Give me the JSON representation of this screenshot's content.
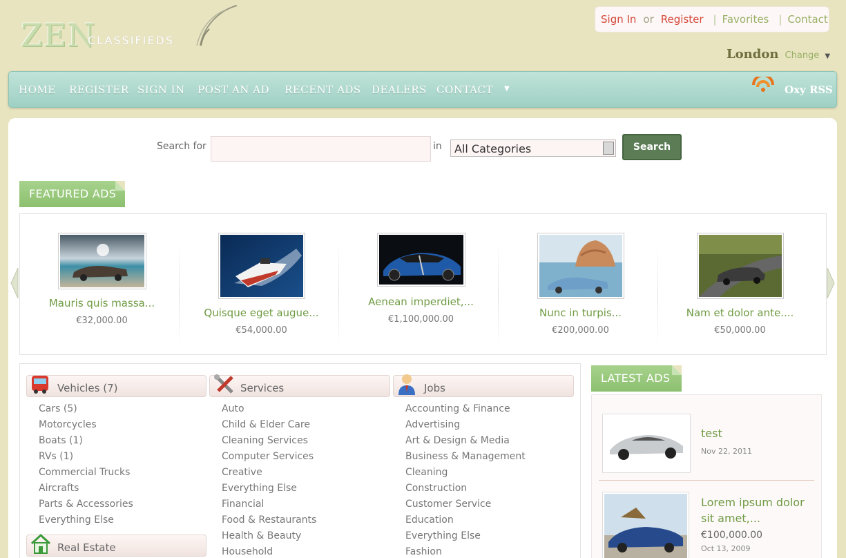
{
  "brand": {
    "logo_main": "ZEN",
    "logo_sub": "CLASSIFIEDS"
  },
  "toplinks": {
    "signin": "Sign In",
    "or": "or",
    "register": "Register",
    "favorites": "Favorites",
    "contact": "Contact"
  },
  "city": {
    "name": "London",
    "change": "Change",
    "arrow": "▼"
  },
  "nav": {
    "items": [
      "HOME",
      "REGISTER",
      "SIGN IN",
      "POST AN AD",
      "RECENT ADS",
      "DEALERS",
      "CONTACT"
    ],
    "dropdown": "▼",
    "rss": "Oxy RSS"
  },
  "search": {
    "label": "Search for",
    "value": "",
    "in": "in",
    "category": "All Categories",
    "button": "Search"
  },
  "featured": {
    "title": "FEATURED ADS",
    "items": [
      {
        "title": "Mauris quis massa...",
        "price": "€32,000.00",
        "image": "convertible-beach-photo"
      },
      {
        "title": "Quisque eget augue...",
        "price": "€54,000.00",
        "image": "speedboat-photo"
      },
      {
        "title": "Aenean imperdiet,...",
        "price": "€1,100,000.00",
        "image": "bugatti-photo"
      },
      {
        "title": "Nunc in turpis...",
        "price": "€200,000.00",
        "image": "blue-convertible-rocks-photo"
      },
      {
        "title": "Nam et dolor ante....",
        "price": "€50,000.00",
        "image": "grey-sedan-road-photo"
      }
    ]
  },
  "categories": {
    "vehicles": {
      "title": "Vehicles (7)",
      "items": [
        "Cars (5)",
        "Motorcycles",
        "Boats (1)",
        "RVs (1)",
        "Commercial Trucks",
        "Aircrafts",
        "Parts & Accessories",
        "Everything Else"
      ]
    },
    "services": {
      "title": "Services",
      "items": [
        "Auto",
        "Child & Elder Care",
        "Cleaning Services",
        "Computer Services",
        "Creative",
        "Everything Else",
        "Financial",
        "Food & Restaurants",
        "Health & Beauty",
        "Household"
      ]
    },
    "jobs": {
      "title": "Jobs",
      "items": [
        "Accounting & Finance",
        "Advertising",
        "Art & Design & Media",
        "Business & Management",
        "Cleaning",
        "Construction",
        "Customer Service",
        "Education",
        "Everything Else",
        "Fashion"
      ]
    },
    "realestate": {
      "title": "Real Estate"
    }
  },
  "latest": {
    "title": "LATEST ADS",
    "items": [
      {
        "title": "test",
        "price": "",
        "date": "Nov 22, 2011",
        "image": "silver-sports-car-photo"
      },
      {
        "title": "Lorem ipsum dolor sit amet,...",
        "price": "€100,000.00",
        "date": "Oct 13, 2009",
        "image": "blue-convertible-photo"
      }
    ]
  },
  "colors": {
    "page_bg": "#e8e4c0",
    "nav": "#a8d6ca",
    "accent_green": "#6f9b43",
    "ribbon": "#9bc97e",
    "link_red": "#d4493a",
    "search_button": "#5b7c55"
  }
}
